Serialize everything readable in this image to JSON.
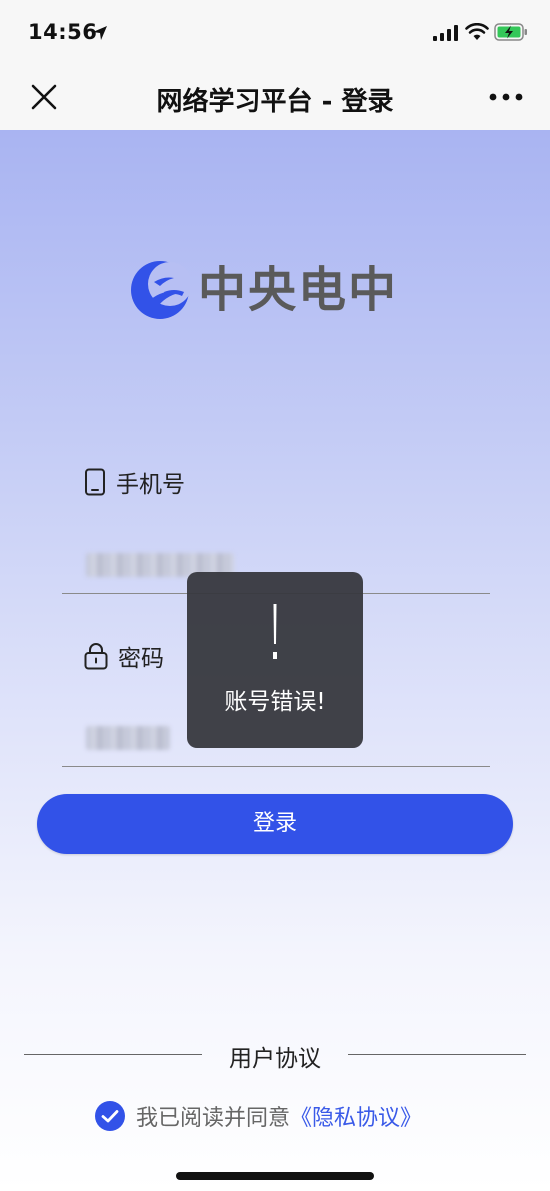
{
  "status_bar": {
    "time": "14:56"
  },
  "nav": {
    "title": "网络学习平台 - 登录"
  },
  "logo": {
    "text": "中央电中",
    "brand_color": "#3252e8"
  },
  "form": {
    "phone_label": "手机号",
    "password_label": "密码"
  },
  "login_button": {
    "label": "登录",
    "color": "#3252e8"
  },
  "toast": {
    "icon": "exclamation-icon",
    "message": "账号错误!"
  },
  "agreement": {
    "title": "用户协议",
    "consent_text": "我已阅读并同意",
    "privacy_link": "《隐私协议》",
    "checked": true
  }
}
